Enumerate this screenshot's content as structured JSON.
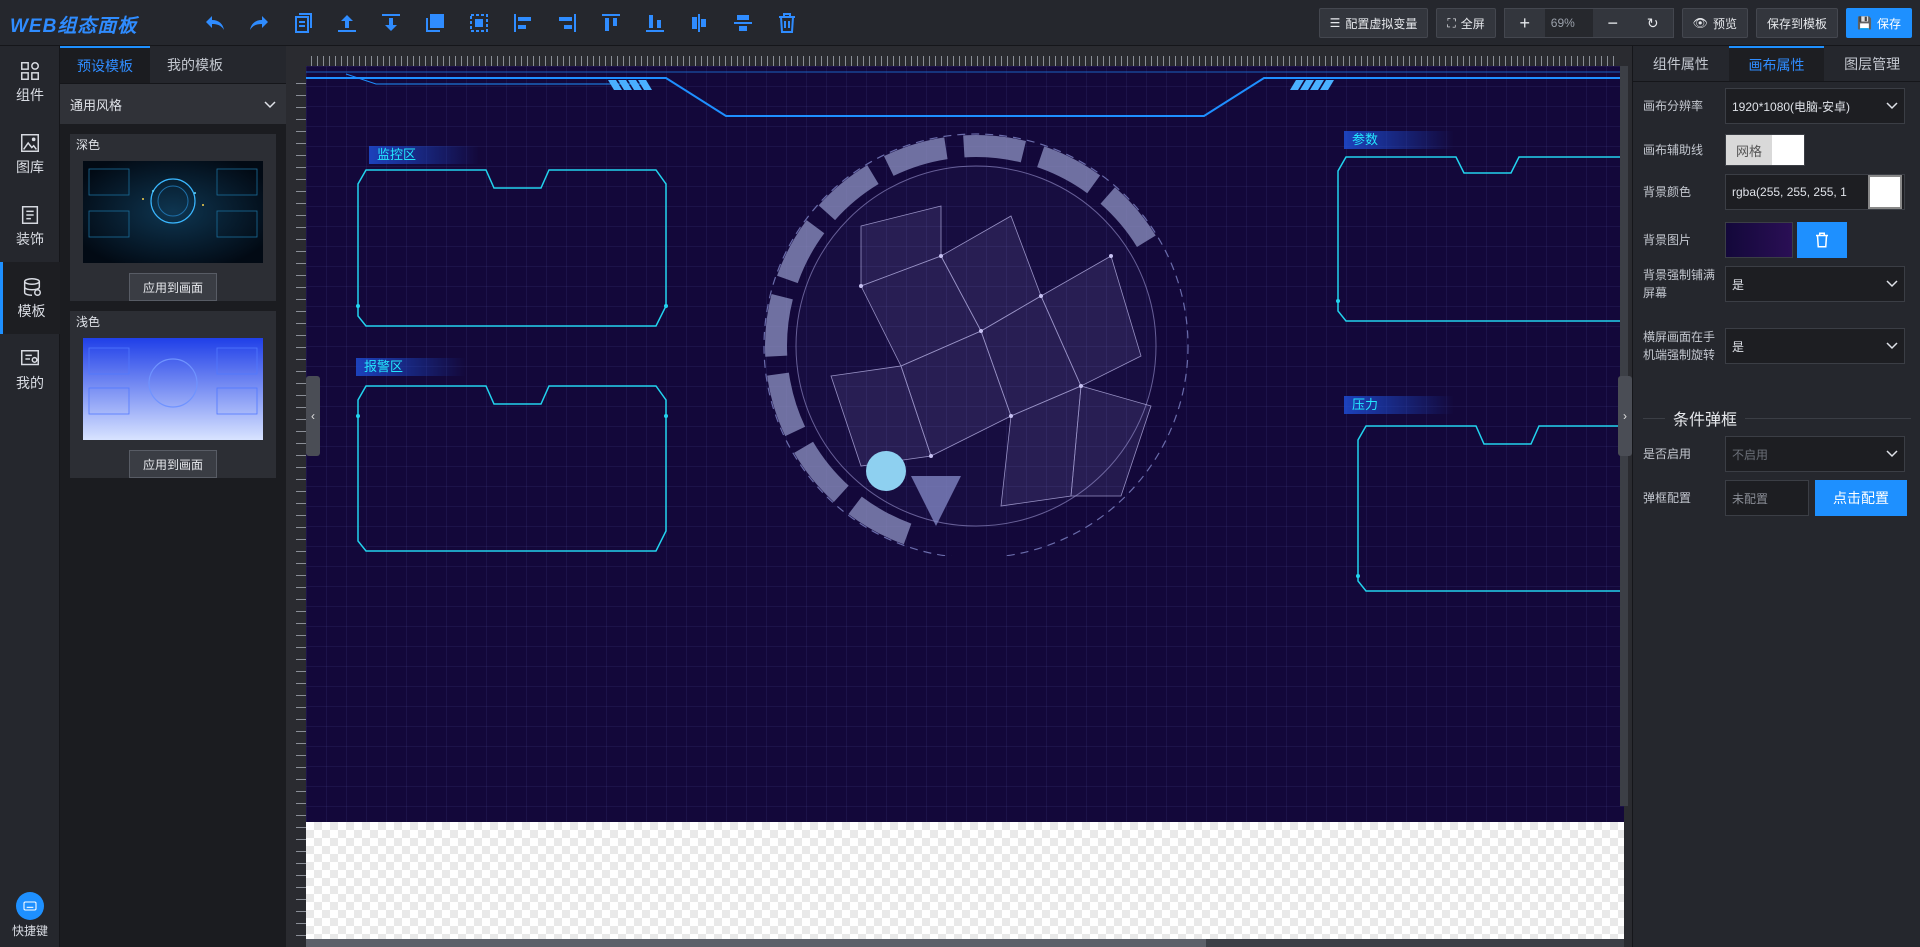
{
  "app": {
    "logo": "WEB组态面板"
  },
  "toolbar": {
    "icons": [
      "undo-icon",
      "redo-icon",
      "copy-icon",
      "bring-forward-icon",
      "send-backward-icon",
      "group-icon",
      "ungroup-icon",
      "align-left-icon",
      "align-right-icon",
      "align-top-icon",
      "align-bottom-icon",
      "align-hcenter-icon",
      "align-vcenter-icon",
      "delete-icon"
    ],
    "virtual_var": "配置虚拟变量",
    "fullscreen": "全屏",
    "zoom_value": "69%",
    "preview": "预览",
    "save_template": "保存到模板",
    "save": "保存"
  },
  "rail": {
    "items": [
      {
        "label": "组件",
        "icon": "component-icon"
      },
      {
        "label": "图库",
        "icon": "gallery-icon"
      },
      {
        "label": "装饰",
        "icon": "decoration-icon"
      },
      {
        "label": "模板",
        "icon": "template-icon",
        "active": true
      },
      {
        "label": "我的",
        "icon": "mine-icon"
      }
    ],
    "shortcut": "快捷键"
  },
  "template_panel": {
    "tabs": [
      "预设模板",
      "我的模板"
    ],
    "style_select": "通用风格",
    "cards": [
      {
        "title": "深色",
        "apply": "应用到画面",
        "theme": "dark"
      },
      {
        "title": "浅色",
        "apply": "应用到画面",
        "theme": "light"
      }
    ]
  },
  "canvas": {
    "labels": [
      "监控区",
      "报警区",
      "参数",
      "压力"
    ],
    "colors": {
      "bg": "#13083a",
      "frame": "#22d3ee",
      "label": "#23e8ff"
    }
  },
  "right_panel": {
    "tabs": [
      "组件属性",
      "画布属性",
      "图层管理"
    ],
    "resolution_label": "画布分辨率",
    "resolution_value": "1920*1080(电脑-安卓)",
    "guide_label": "画布辅助线",
    "guide_value": "网格",
    "bgcolor_label": "背景颜色",
    "bgcolor_value": "rgba(255, 255, 255, 1",
    "bgimage_label": "背景图片",
    "fill_label": "背景强制铺满屏幕",
    "fill_value": "是",
    "rotate_label": "横屏画面在手机端强制旋转",
    "rotate_value": "是",
    "section_title": "条件弹框",
    "enable_label": "是否启用",
    "enable_placeholder": "不启用",
    "popup_label": "弹框配置",
    "popup_value": "未配置",
    "popup_btn": "点击配置"
  }
}
